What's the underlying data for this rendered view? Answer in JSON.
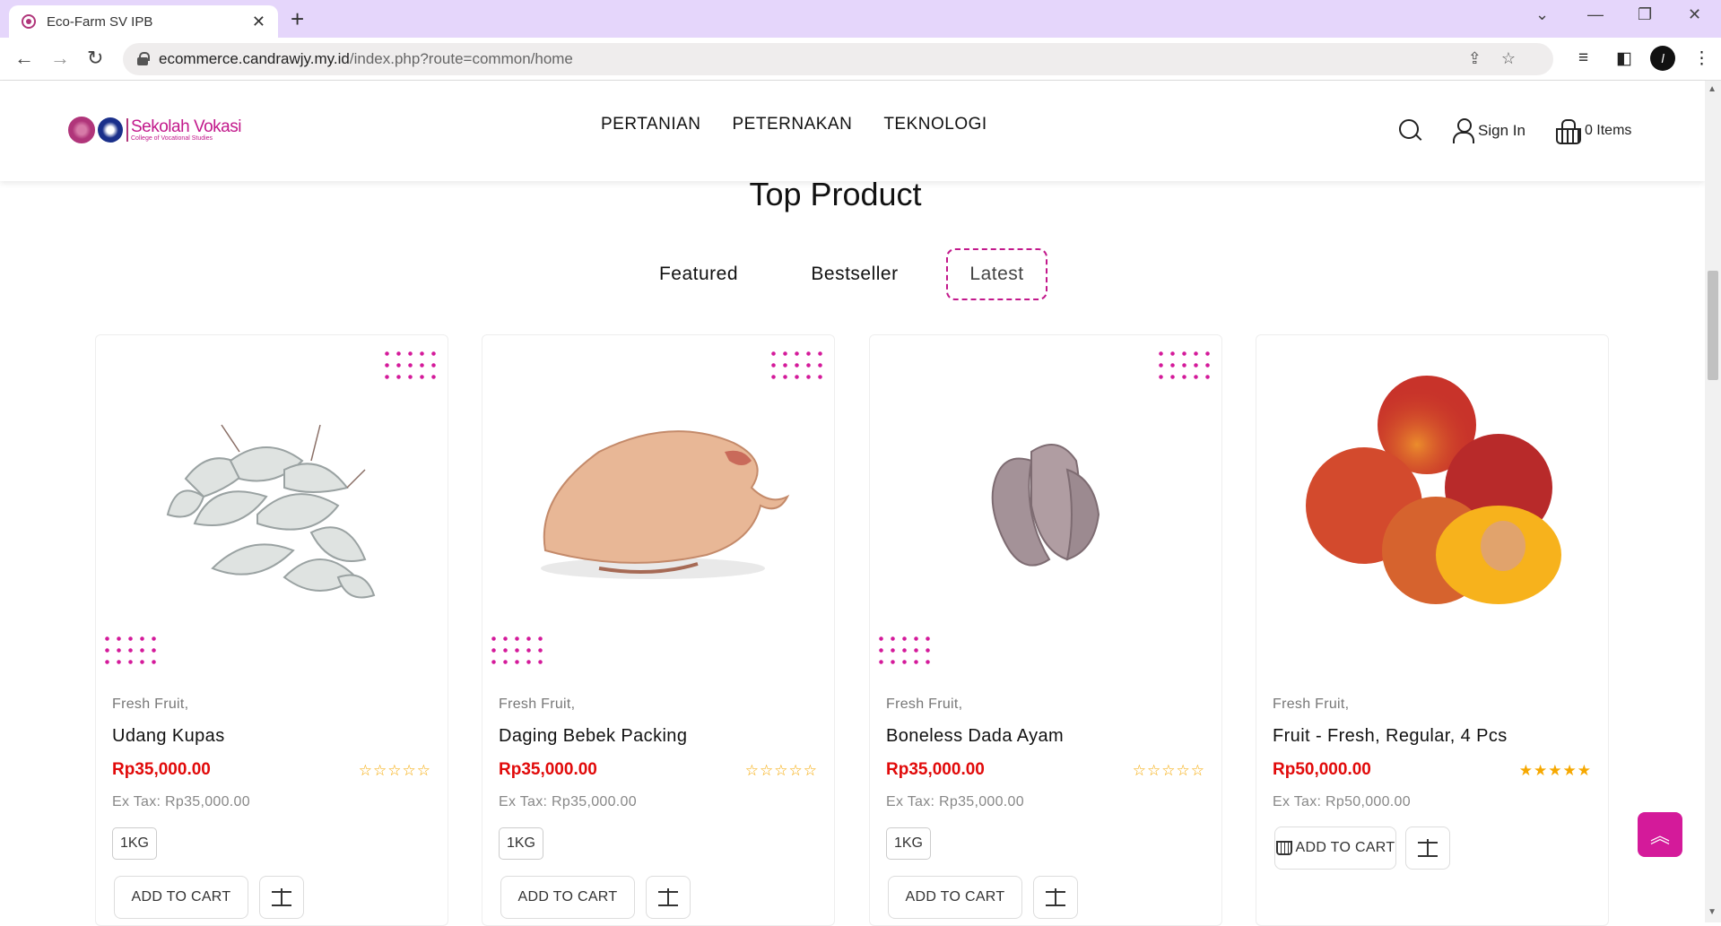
{
  "browser": {
    "tab_title": "Eco-Farm SV IPB",
    "tab_close": "✕",
    "new_tab": "+",
    "url_host": "ecommerce.candrawjy.my.id",
    "url_path": "/index.php?route=common/home",
    "profile_initial": "l"
  },
  "header": {
    "logo_name": "Sekolah Vokasi",
    "logo_sub": "College of Vocational Studies",
    "nav": [
      "PERTANIAN",
      "PETERNAKAN",
      "TEKNOLOGI"
    ],
    "sign_in": "Sign In",
    "cart": "0 Items"
  },
  "section": {
    "title": "Top Product",
    "tabs": [
      "Featured",
      "Bestseller",
      "Latest"
    ],
    "active_tab": "Latest"
  },
  "products": [
    {
      "category": "Fresh Fruit,",
      "name": "Udang Kupas",
      "price": "Rp35,000.00",
      "ex_tax": "Ex Tax: Rp35,000.00",
      "option": "1KG",
      "rating": 0,
      "stars": "☆☆☆☆☆",
      "add_to_cart": "ADD TO CART"
    },
    {
      "category": "Fresh Fruit,",
      "name": "Daging Bebek Packing",
      "price": "Rp35,000.00",
      "ex_tax": "Ex Tax: Rp35,000.00",
      "option": "1KG",
      "rating": 0,
      "stars": "☆☆☆☆☆",
      "add_to_cart": "ADD TO CART"
    },
    {
      "category": "Fresh Fruit,",
      "name": "Boneless Dada Ayam",
      "price": "Rp35,000.00",
      "ex_tax": "Ex Tax: Rp35,000.00",
      "option": "1KG",
      "rating": 0,
      "stars": "☆☆☆☆☆",
      "add_to_cart": "ADD TO CART"
    },
    {
      "category": "Fresh Fruit,",
      "name": "Fruit - Fresh, Regular, 4 Pcs",
      "price": "Rp50,000.00",
      "ex_tax": "Ex Tax: Rp50,000.00",
      "rating": 5,
      "stars": "★★★★★",
      "add_to_cart": "ADD TO CART"
    }
  ],
  "colors": {
    "accent": "#d41a9a",
    "price": "#e10a0a",
    "star": "#f6a800",
    "tabbar": "#e5d6fb"
  },
  "icons": [
    "search-icon",
    "user-icon",
    "basket-icon",
    "scale-icon",
    "chevron-up-icon"
  ]
}
